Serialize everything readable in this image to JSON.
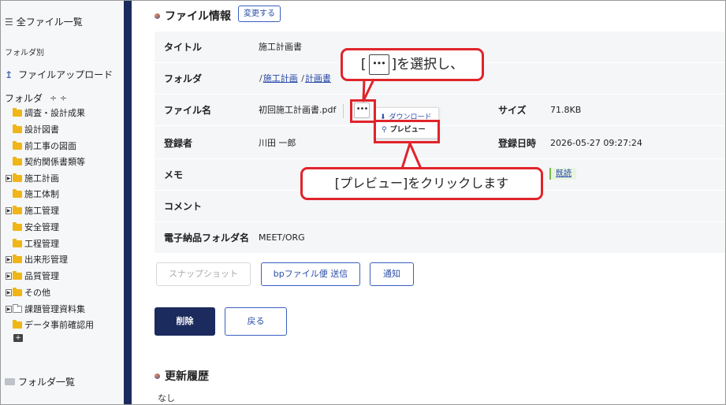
{
  "sidebar": {
    "all_files": "全ファイル一覧",
    "folder_section": "フォルダ別",
    "upload": "ファイルアップロード",
    "folder_heading": "フォルダ",
    "tree": [
      {
        "label": "調査・設計成果",
        "expander": false
      },
      {
        "label": "設計図書",
        "expander": false
      },
      {
        "label": "前工事の図面",
        "expander": false
      },
      {
        "label": "契約関係書類等",
        "expander": false
      },
      {
        "label": "施工計画",
        "expander": true
      },
      {
        "label": "施工体制",
        "expander": false
      },
      {
        "label": "施工管理",
        "expander": true
      },
      {
        "label": "安全管理",
        "expander": false
      },
      {
        "label": "工程管理",
        "expander": false
      },
      {
        "label": "出来形管理",
        "expander": true
      },
      {
        "label": "品質管理",
        "expander": true
      },
      {
        "label": "その他",
        "expander": true
      },
      {
        "label": "課題管理資料集",
        "expander": true,
        "open": true
      },
      {
        "label": "データ事前確認用",
        "expander": false
      }
    ],
    "folder_list": "フォルダ一覧"
  },
  "file_info": {
    "title": "ファイル情報",
    "edit_button": "変更する",
    "rows": {
      "title": {
        "label": "タイトル",
        "value": "施工計画書"
      },
      "folder": {
        "label": "フォルダ",
        "sep1": "/",
        "link1": "施工計画",
        "sep2": "/",
        "link2": "計画書"
      },
      "filename": {
        "label": "ファイル名",
        "value": "初回施工計画書.pdf",
        "size_label": "サイズ",
        "size_value": "71.8KB"
      },
      "registrant": {
        "label": "登録者",
        "value": "川田 一郎",
        "date_label": "登録日時",
        "date_value": "2026-05-27 09:27:24"
      },
      "memo": {
        "label": "メモ",
        "link": "既読"
      },
      "comment": {
        "label": "コメント"
      },
      "e_delivery": {
        "label": "電子納品フォルダ名",
        "value": "MEET/ORG"
      }
    },
    "more_button": "•••",
    "menu": {
      "download": "ダウンロード",
      "preview": "プレビュー"
    }
  },
  "actions": {
    "snapshot": "スナップショット",
    "bp_send": "bpファイル便 送信",
    "notify": "通知",
    "delete": "削除",
    "back": "戻る"
  },
  "history": {
    "title": "更新履歴",
    "empty": "なし"
  },
  "annotations": {
    "callout1_pre": "[",
    "callout1_key": "•••",
    "callout1_post": "]を選択し、",
    "callout2": "[プレビュー]をクリックします",
    "accent_color": "#e0242b"
  }
}
